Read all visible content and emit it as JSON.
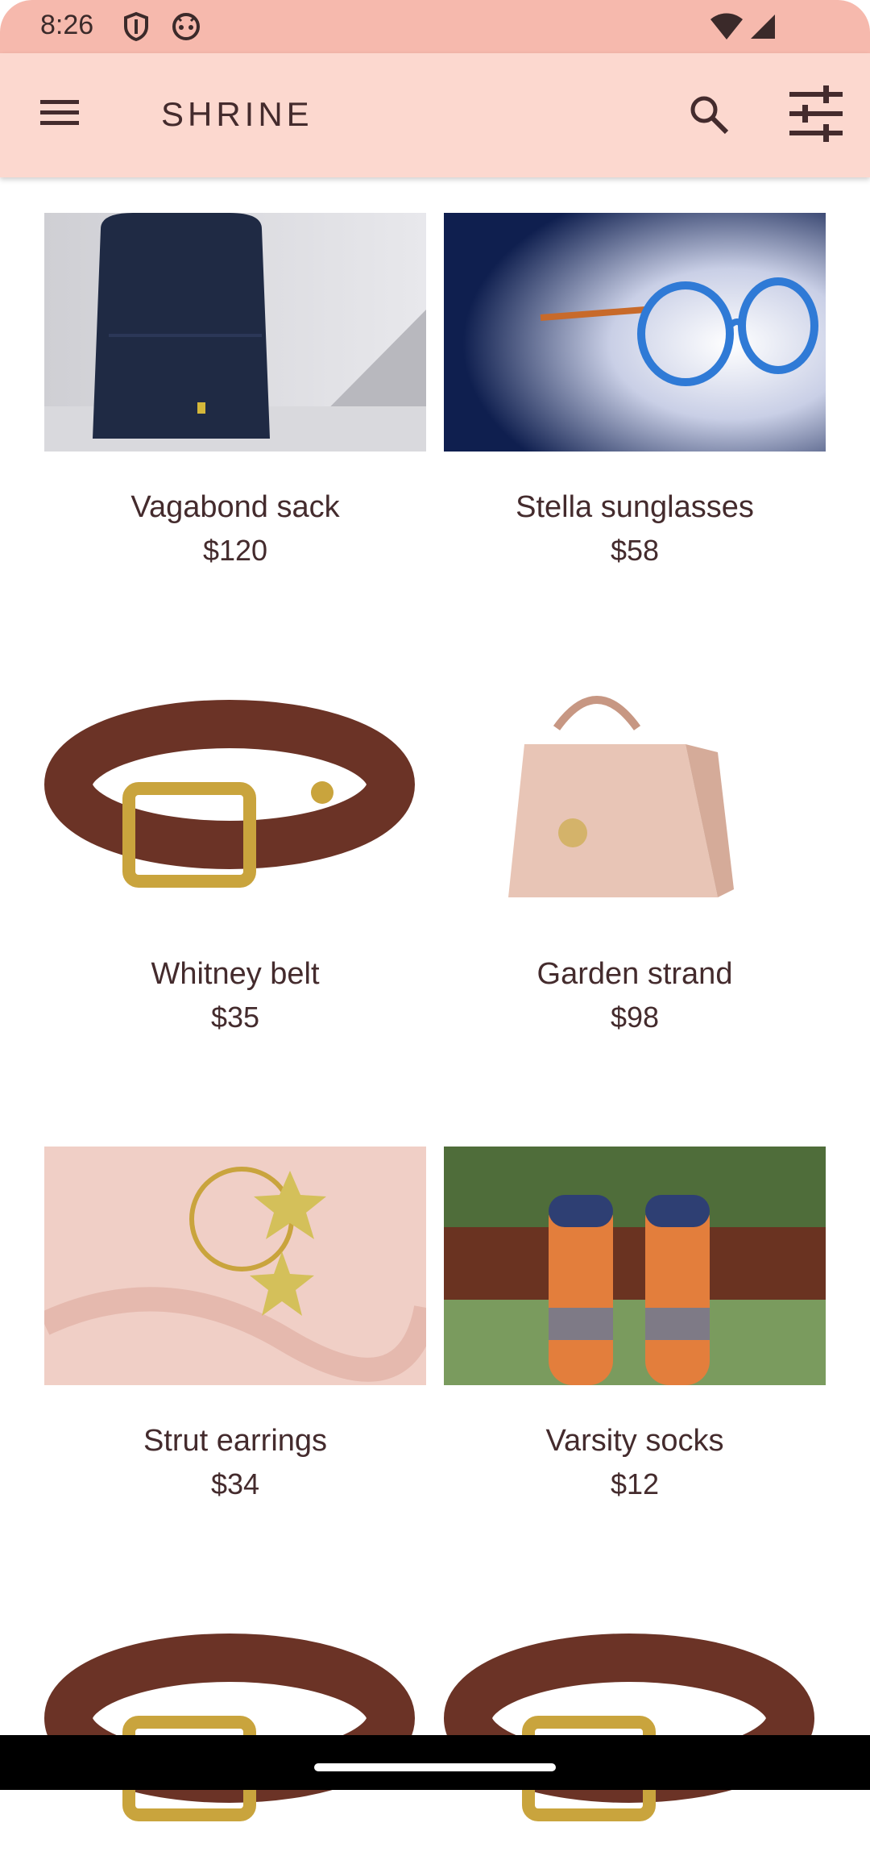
{
  "status_bar": {
    "time": "8:26",
    "icons": [
      "shield-icon",
      "android-icon",
      "wifi-icon",
      "signal-icon"
    ]
  },
  "app_bar": {
    "title": "SHRINE",
    "menu_icon": "menu-icon",
    "search_icon": "search-icon",
    "filter_icon": "tune-icon"
  },
  "products": [
    {
      "name": "Vagabond sack",
      "price": "$120",
      "image": "backpack"
    },
    {
      "name": "Stella sunglasses",
      "price": "$58",
      "image": "glasses"
    },
    {
      "name": "Whitney belt",
      "price": "$35",
      "image": "belt"
    },
    {
      "name": "Garden strand",
      "price": "$98",
      "image": "handbag"
    },
    {
      "name": "Strut earrings",
      "price": "$34",
      "image": "earrings"
    },
    {
      "name": "Varsity socks",
      "price": "$12",
      "image": "socks"
    }
  ],
  "partial_row_images": [
    "belt",
    "belt"
  ],
  "colors": {
    "status_bar": "#f6b9ad",
    "app_bar": "#fcd8cf",
    "text": "#442b2d"
  }
}
